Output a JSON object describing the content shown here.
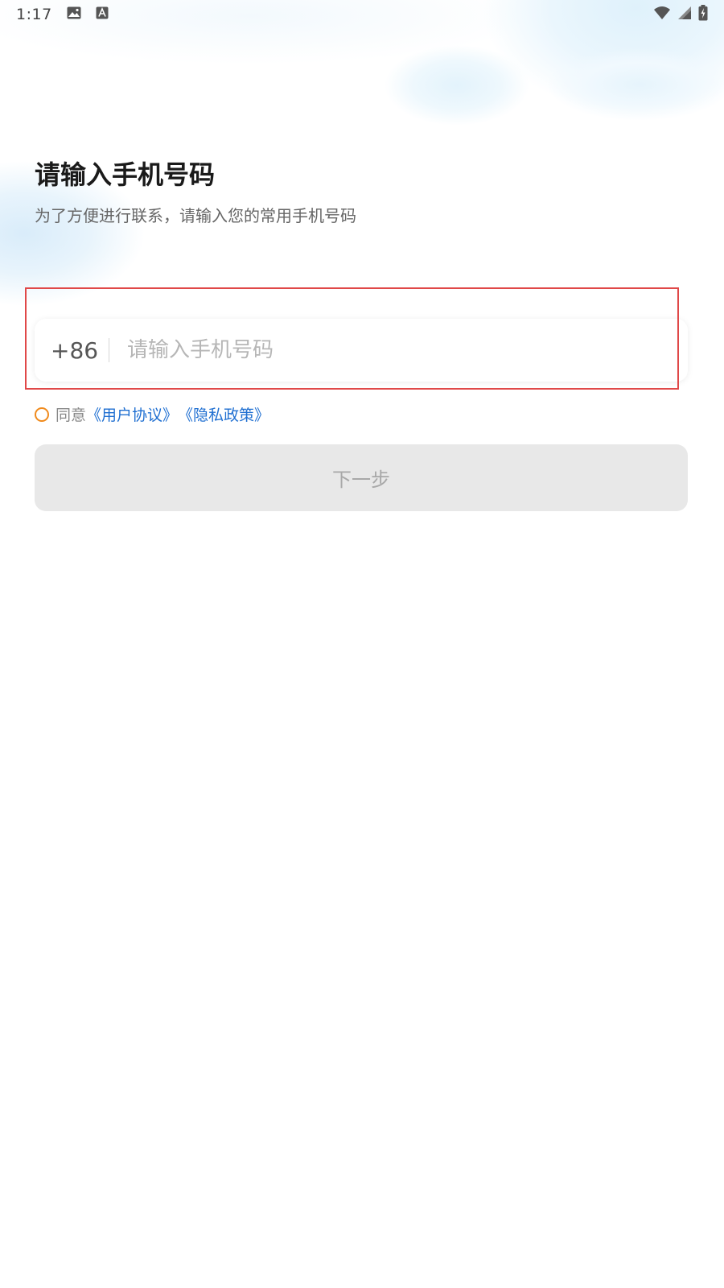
{
  "status_bar": {
    "time": "1:17",
    "icons": [
      "image-icon",
      "font-icon",
      "wifi-icon",
      "cell-signal-icon",
      "battery-charging-icon"
    ]
  },
  "header": {
    "title": "请输入手机号码",
    "subtitle": "为了方便进行联系，请输入您的常用手机号码"
  },
  "phone_form": {
    "country_code": "+86",
    "input_value": "",
    "input_placeholder": "请输入手机号码"
  },
  "agreement": {
    "prefix": "同意",
    "user_agreement": "《用户协议》",
    "privacy_policy": "《隐私政策》",
    "checked": false
  },
  "next_button": {
    "label": "下一步",
    "enabled": false
  },
  "colors": {
    "accent_link": "#1f6fd1",
    "check_orange": "#f08a1c",
    "disabled_button_bg": "#e8e8e8",
    "highlight_red": "#e04848"
  }
}
